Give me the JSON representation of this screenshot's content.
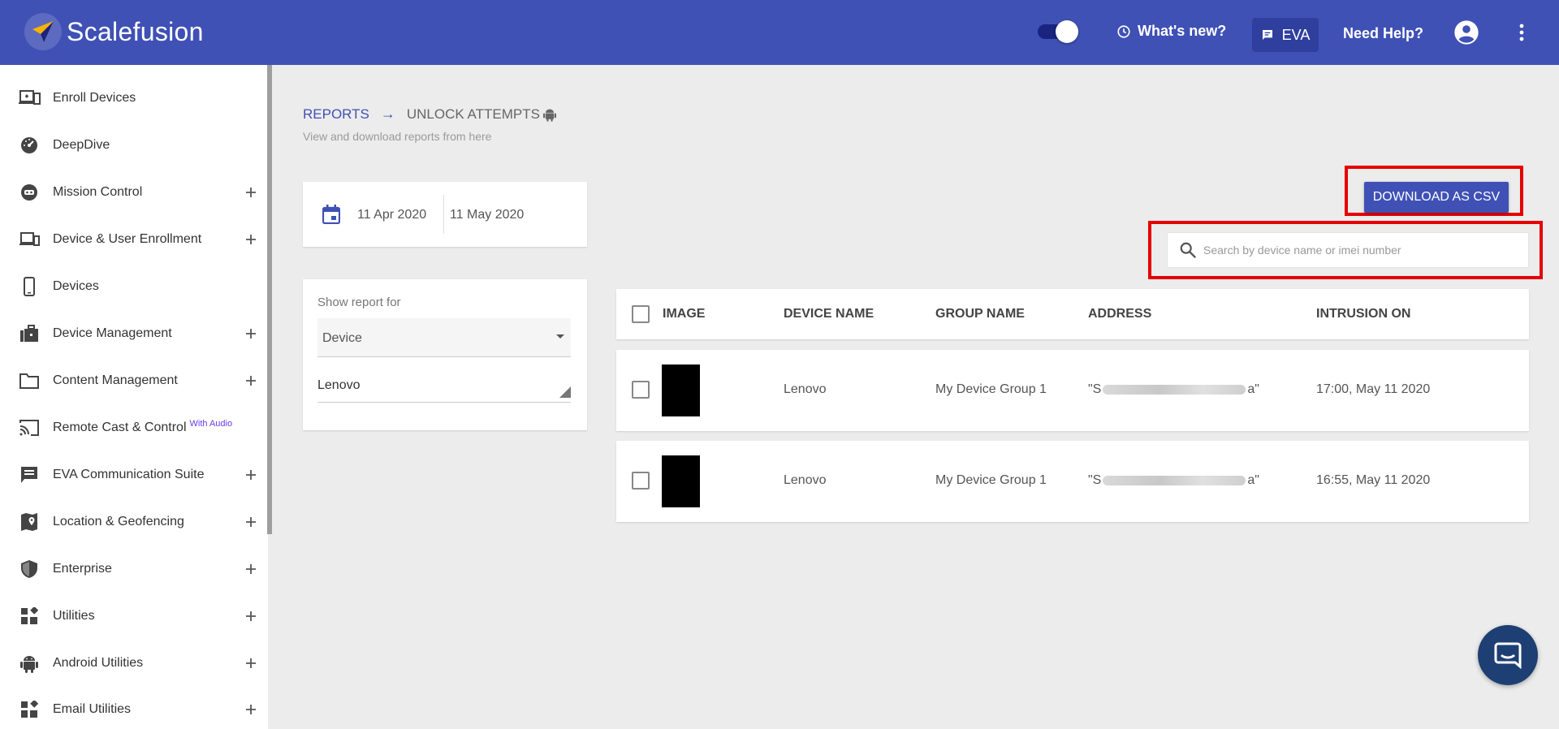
{
  "header": {
    "brand": "Scalefusion",
    "whats_new": "What's new?",
    "eva": "EVA",
    "need_help": "Need Help?"
  },
  "sidebar": {
    "items": [
      {
        "label": "Enroll Devices",
        "icon": "enroll-devices-icon",
        "expandable": false
      },
      {
        "label": "DeepDive",
        "icon": "speedometer-icon",
        "expandable": false
      },
      {
        "label": "Mission Control",
        "icon": "mission-control-icon",
        "expandable": true
      },
      {
        "label": "Device & User Enrollment",
        "icon": "devices-icon",
        "expandable": true
      },
      {
        "label": "Devices",
        "icon": "phone-icon",
        "expandable": false
      },
      {
        "label": "Device Management",
        "icon": "briefcase-icon",
        "expandable": true
      },
      {
        "label": "Content Management",
        "icon": "folder-icon",
        "expandable": true
      },
      {
        "label": "Remote Cast & Control",
        "badge": "With Audio",
        "icon": "cast-icon",
        "expandable": false
      },
      {
        "label": "EVA Communication Suite",
        "icon": "chat-icon",
        "expandable": true
      },
      {
        "label": "Location & Geofencing",
        "icon": "map-pin-icon",
        "expandable": true
      },
      {
        "label": "Enterprise",
        "icon": "shield-icon",
        "expandable": true
      },
      {
        "label": "Utilities",
        "icon": "widgets-icon",
        "expandable": true
      },
      {
        "label": "Android Utilities",
        "icon": "android-icon",
        "expandable": true
      },
      {
        "label": "Email Utilities",
        "icon": "widgets-icon",
        "expandable": true
      }
    ]
  },
  "breadcrumb": {
    "parent": "REPORTS",
    "arrow": "→",
    "current": "UNLOCK ATTEMPTS"
  },
  "subtitle": "View and download reports from here",
  "date_range": {
    "from": "11 Apr 2020",
    "to": "11 May 2020"
  },
  "filter": {
    "label": "Show report for",
    "selected": "Device",
    "value": "Lenovo"
  },
  "download_button": "DOWNLOAD AS CSV",
  "search": {
    "placeholder": "Search by device name or imei number"
  },
  "table": {
    "headers": {
      "image": "IMAGE",
      "device_name": "DEVICE NAME",
      "group_name": "GROUP NAME",
      "address": "ADDRESS",
      "intrusion_on": "INTRUSION ON"
    },
    "rows": [
      {
        "device_name": "Lenovo",
        "group_name": "My Device Group 1",
        "address_start": "\"S",
        "address_end": "a\"",
        "intrusion_on": "17:00, May 11 2020"
      },
      {
        "device_name": "Lenovo",
        "group_name": "My Device Group 1",
        "address_start": "\"S",
        "address_end": "a\"",
        "intrusion_on": "16:55, May 11 2020"
      }
    ]
  },
  "colors": {
    "primary": "#3f51b5",
    "highlight": "#e60000",
    "fab": "#1e3f73"
  }
}
